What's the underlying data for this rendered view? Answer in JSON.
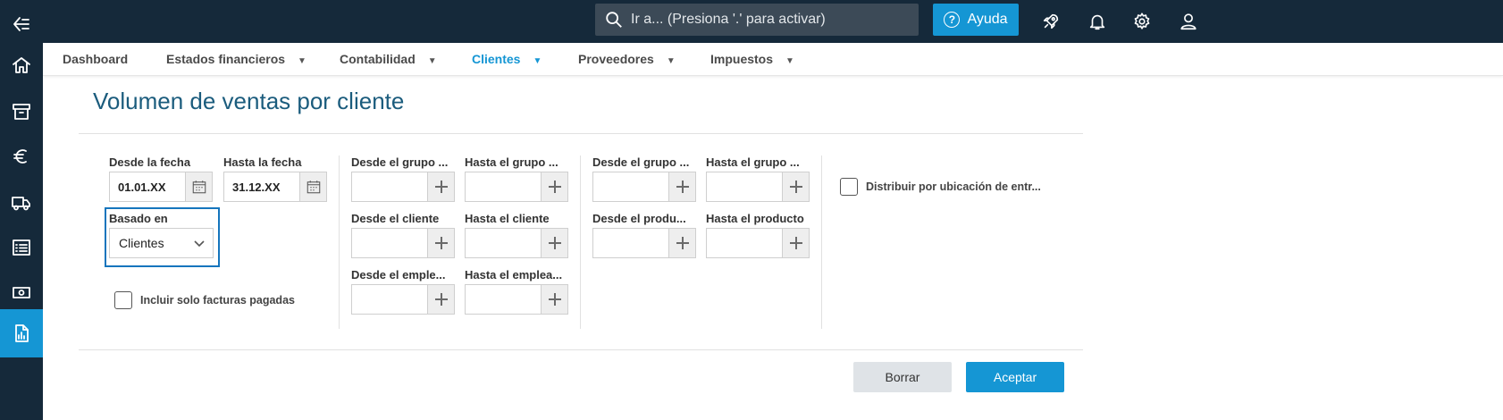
{
  "topbar": {
    "search_placeholder": "Ir a... (Presiona '.' para activar)",
    "help_label": "Ayuda"
  },
  "nav": {
    "items": [
      {
        "label": "Dashboard"
      },
      {
        "label": "Estados financieros",
        "caret": "▼"
      },
      {
        "label": "Contabilidad",
        "caret": "▼"
      },
      {
        "label": "Clientes",
        "caret": "▼"
      },
      {
        "label": "Proveedores",
        "caret": "▼"
      },
      {
        "label": "Impuestos",
        "caret": "▼"
      }
    ],
    "active": "Clientes"
  },
  "page": {
    "title": "Volumen de ventas por cliente"
  },
  "form": {
    "from_date": {
      "label": "Desde la fecha",
      "value": "01.01.XX"
    },
    "to_date": {
      "label": "Hasta la fecha",
      "value": "31.12.XX"
    },
    "based_on": {
      "label": "Basado en",
      "value": "Clientes"
    },
    "only_paid": {
      "label": "Incluir solo facturas pagadas",
      "checked": false
    },
    "col2": {
      "from_group": "Desde el grupo ...",
      "to_group": "Hasta el grupo ...",
      "from_customer": "Desde el cliente",
      "to_customer": "Hasta el cliente",
      "from_employee": "Desde el emple...",
      "to_employee": "Hasta el emplea..."
    },
    "col3": {
      "from_group": "Desde el grupo ...",
      "to_group": "Hasta el grupo ...",
      "from_product": "Desde el produ...",
      "to_product": "Hasta el producto"
    },
    "distribute": {
      "label": "Distribuir por ubicación de entr...",
      "checked": false
    }
  },
  "actions": {
    "clear": "Borrar",
    "accept": "Aceptar"
  },
  "colors": {
    "sidebar": "#15293a",
    "accent": "#1596d4",
    "title": "#1b5c7d"
  }
}
